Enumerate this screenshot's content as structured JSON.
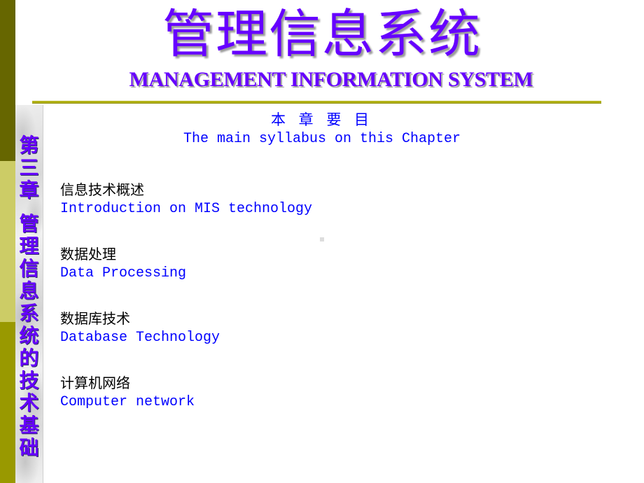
{
  "slide": {
    "title_cn": "管理信息系统",
    "title_en": "MANAGEMENT INFORMATION SYSTEM",
    "side_title_chars": [
      "第",
      "三",
      "章",
      "",
      "管",
      "理",
      "信",
      "息",
      "系",
      "统",
      "的",
      "技",
      "术",
      "基",
      "础"
    ],
    "side_title": "第三章 管理信息系统的技术基础",
    "syllabus_heading_cn": "本 章 要 目",
    "syllabus_heading_en": "The main syllabus on this Chapter",
    "topics": [
      {
        "cn": "信息技术概述",
        "en": "Introduction on MIS technology"
      },
      {
        "cn": "数据处理",
        "en": "Data Processing"
      },
      {
        "cn": "数据库技术",
        "en": "Database Technology"
      },
      {
        "cn": "计算机网络",
        "en": "Computer network"
      }
    ]
  },
  "colors": {
    "title": "#6600ff",
    "body_link": "#0000ff",
    "body_text": "#000000",
    "bar_dark": "#666600",
    "bar_light": "#cccc66",
    "bar_mid": "#999900",
    "rule": "#b3b31a"
  }
}
